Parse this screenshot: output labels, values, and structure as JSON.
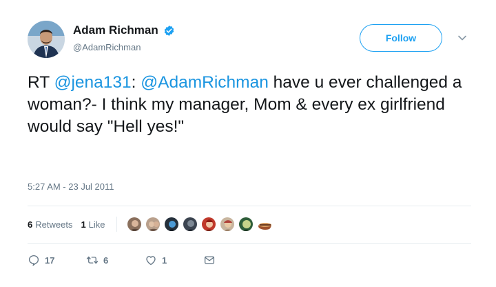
{
  "author": {
    "display_name": "Adam Richman",
    "handle": "@AdamRichman",
    "verified": true,
    "avatar_icon": "avatar-photo"
  },
  "header": {
    "follow_label": "Follow",
    "more_icon": "chevron-down-icon"
  },
  "tweet": {
    "prefix": "RT ",
    "mention_1": "@jena131",
    "sep": ": ",
    "mention_2": "@AdamRichman",
    "text": " have u ever challenged a woman?- I think my manager, Mom & every ex girlfriend would say \"Hell yes!\"",
    "timestamp": "5:27 AM - 23 Jul 2011"
  },
  "stats": {
    "retweets_count": "6",
    "retweets_label": "Retweets",
    "likes_count": "1",
    "likes_label": "Like",
    "liker_avatars": 8
  },
  "actions": {
    "reply_count": "17",
    "retweet_count": "6",
    "like_count": "1"
  },
  "colors": {
    "accent": "#1da1f2",
    "link": "#1b95e0",
    "muted": "#657786",
    "text": "#14171a"
  }
}
